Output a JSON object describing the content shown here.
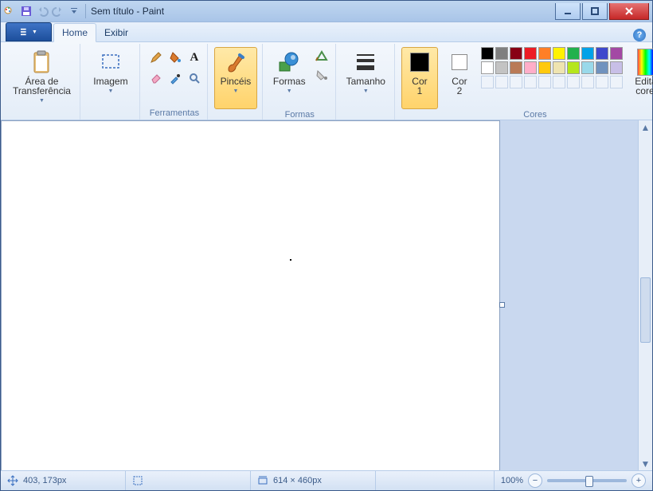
{
  "title": "Sem título - Paint",
  "tabs": {
    "file": "",
    "home": "Home",
    "view": "Exibir"
  },
  "groups": {
    "clipboard": {
      "label": "",
      "paste": "Área de\nTransferência"
    },
    "image": {
      "label": "",
      "btn": "Imagem"
    },
    "tools": {
      "label": "Ferramentas"
    },
    "brushes": {
      "label": "",
      "btn": "Pincéis"
    },
    "shapes": {
      "label": "Formas",
      "btn": "Formas"
    },
    "size": {
      "label": "",
      "btn": "Tamanho"
    },
    "colors": {
      "label": "Cores",
      "c1": "Cor\n1",
      "c2": "Cor\n2",
      "edit": "Editar\ncores"
    }
  },
  "palette_row1": [
    "#000000",
    "#7f7f7f",
    "#880015",
    "#ed1c24",
    "#ff7f27",
    "#fff200",
    "#22b14c",
    "#00a2e8",
    "#3f48cc",
    "#a349a4"
  ],
  "palette_row2": [
    "#ffffff",
    "#c3c3c3",
    "#b97a57",
    "#ffaec9",
    "#ffc90e",
    "#efe4b0",
    "#b5e61d",
    "#99d9ea",
    "#7092be",
    "#c8bfe7"
  ],
  "color1": "#000000",
  "color2": "#ffffff",
  "status": {
    "pos": "403, 173px",
    "sel": "",
    "size": "614 × 460px",
    "zoom": "100%"
  }
}
